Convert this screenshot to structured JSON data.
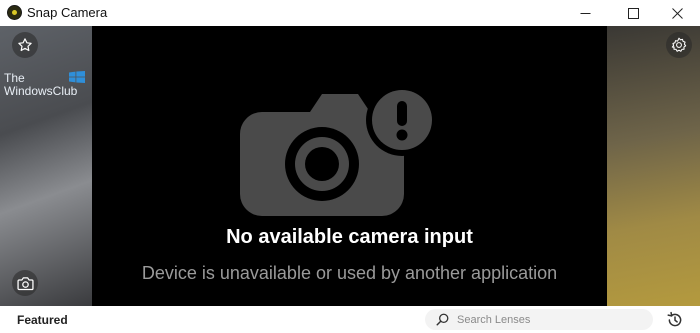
{
  "window": {
    "title": "Snap Camera",
    "minimize_glyph": "—",
    "maximize_glyph": "☐",
    "close_glyph": "✕"
  },
  "watermark": {
    "line1": "The",
    "line2": "WindowsClub"
  },
  "message": {
    "title": "No available camera input",
    "subtitle": "Device is unavailable or used by another application"
  },
  "bottom": {
    "featured_label": "Featured",
    "search_placeholder": "Search Lenses"
  },
  "icons": {
    "favorite": "star-icon",
    "settings": "gear-icon",
    "snapshot": "camera-icon",
    "search": "search-icon",
    "history": "history-icon",
    "error": "camera-alert-icon"
  },
  "colors": {
    "viewport_bg": "#000000",
    "message_title": "#ffffff",
    "message_subtitle": "#9a9a9a",
    "camera_graphic": "#4a4a4a"
  }
}
